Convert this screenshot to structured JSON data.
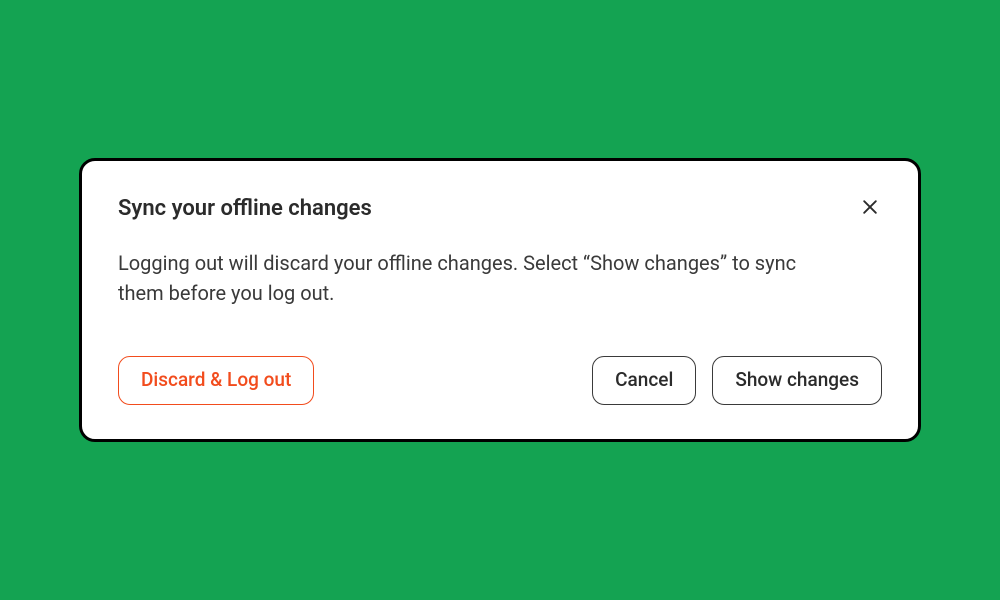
{
  "dialog": {
    "title": "Sync your offline changes",
    "body": "Logging out will discard your offline changes. Select “Show changes” to sync them before you log out.",
    "buttons": {
      "discard": "Discard & Log out",
      "cancel": "Cancel",
      "show": "Show changes"
    }
  },
  "colors": {
    "background": "#14a352",
    "danger": "#f24c1d",
    "text": "#2b2b2b"
  }
}
